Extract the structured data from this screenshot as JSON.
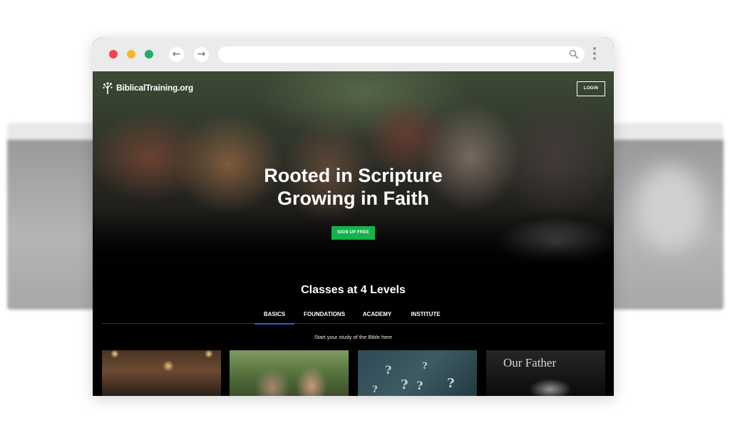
{
  "site": {
    "logo_text": "BiblicalTraining.org",
    "login_label": "LOGIN"
  },
  "hero": {
    "title_line1": "Rooted in Scripture",
    "title_line2": "Growing in Faith",
    "cta_label": "SIGN UP FREE"
  },
  "classes": {
    "title": "Classes at 4 Levels",
    "tabs": [
      {
        "label": "BASICS",
        "active": true
      },
      {
        "label": "FOUNDATIONS",
        "active": false
      },
      {
        "label": "ACADEMY",
        "active": false
      },
      {
        "label": "INSTITUTE",
        "active": false
      }
    ],
    "subtitle": "Start your study of the Bible here",
    "cards": [
      {
        "text": ""
      },
      {
        "text": ""
      },
      {
        "text": ""
      },
      {
        "text": "Our Father"
      }
    ]
  },
  "colors": {
    "accent_green": "#14b34b",
    "tab_underline": "#3b58c8",
    "traffic_red": "#f0474f",
    "traffic_yellow": "#f6b72c",
    "traffic_green": "#1fad63"
  },
  "icons": {
    "back": "arrow-left-icon",
    "forward": "arrow-right-icon",
    "search": "search-icon",
    "menu": "kebab-menu-icon",
    "logo": "tree-logo-icon"
  }
}
